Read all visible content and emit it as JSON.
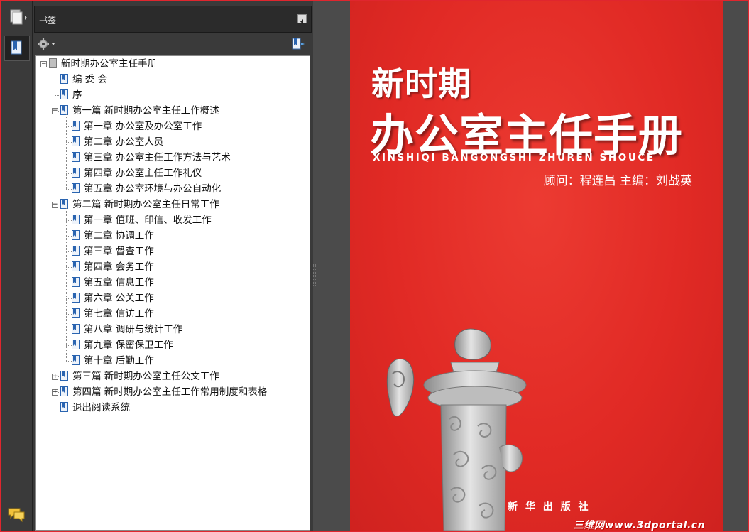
{
  "panel": {
    "title": "书签"
  },
  "icons": {
    "pages": "pages-icon",
    "bookmarks": "bookmark-panel-icon",
    "comments": "comments-icon",
    "options": "gear-icon",
    "new_bookmark": "new-bookmark-icon",
    "collapse": "collapse-panel-icon"
  },
  "bookmarks": {
    "root": "新时期办公室主任手册",
    "items": [
      "编 委 会",
      "序",
      "第一篇 新时期办公室主任工作概述",
      "第一章 办公室及办公室工作",
      "第二章 办公室人员",
      "第三章 办公室主任工作方法与艺术",
      "第四章 办公室主任工作礼仪",
      "第五章 办公室环境与办公自动化",
      "第二篇 新时期办公室主任日常工作",
      "第一章 值班、印信、收发工作",
      "第二章 协调工作",
      "第三章 督查工作",
      "第四章 会务工作",
      "第五章 信息工作",
      "第六章 公关工作",
      "第七章 信访工作",
      "第八章 调研与统计工作",
      "第九章 保密保卫工作",
      "第十章 后勤工作",
      "第三篇 新时期办公室主任公文工作",
      "第四篇 新时期办公室主任工作常用制度和表格",
      "退出阅读系统"
    ]
  },
  "cover": {
    "top_title": "新时期",
    "main_title": "办公室主任手册",
    "pinyin": "XINSHIQI BANGONGSHI ZHUREN SHOUCE",
    "credits": "顾问：程连昌 主编：刘战英",
    "publisher": "新 华 出 版 社",
    "bg_color": "#e12a25"
  },
  "watermark": {
    "cn": "三维网",
    "url": "www.3dportal.cn"
  }
}
